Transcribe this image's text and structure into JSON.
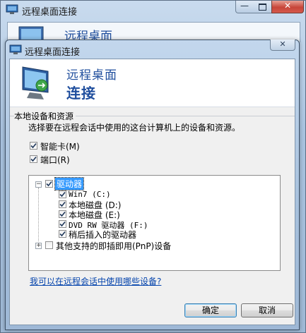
{
  "background_window": {
    "title": "远程桌面连接",
    "brand": "远程桌面",
    "minimize_glyph": "—",
    "close_glyph": "✕"
  },
  "dialog": {
    "title": "远程桌面连接",
    "close_glyph": "✕",
    "brand_line1": "远程桌面",
    "brand_line2": "连接"
  },
  "local_devices": {
    "group_title": "本地设备和资源",
    "description": "选择要在远程会话中使用的这台计算机上的设备和资源。",
    "items": [
      {
        "label": "智能卡(M)",
        "checked": true
      },
      {
        "label": "端口(R)",
        "checked": true
      }
    ],
    "tree": {
      "drives": {
        "label": "驱动器",
        "checked": true,
        "children": [
          {
            "label": "Win7 (C:)",
            "checked": true
          },
          {
            "label": "本地磁盘 (D:)",
            "checked": true
          },
          {
            "label": "本地磁盘 (E:)",
            "checked": true
          },
          {
            "label": "DVD RW 驱动器 (F:)",
            "checked": true
          },
          {
            "label": "稍后插入的驱动器",
            "checked": true
          }
        ]
      },
      "pnp": {
        "label": "其他支持的即插即用(PnP)设备",
        "checked": false
      }
    },
    "help_link": "我可以在远程会话中使用哪些设备?"
  },
  "buttons": {
    "ok": "确定",
    "cancel": "取消"
  },
  "colors": {
    "brand_blue": "#1f4e9d",
    "selection": "#3399ff",
    "link": "#0645ad"
  }
}
